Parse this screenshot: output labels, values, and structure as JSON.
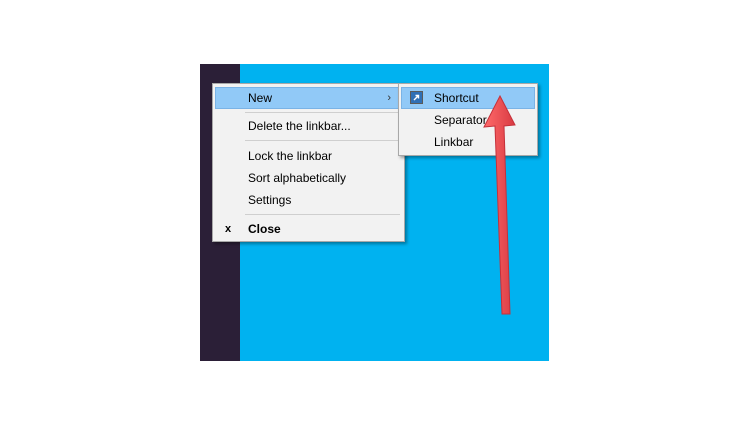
{
  "colors": {
    "desktop": "#00b2f0",
    "taskbar": "#2b1f37",
    "menu_bg": "#f2f2f2",
    "highlight": "#91c9f7",
    "arrow": "#e8474d"
  },
  "context_menu": {
    "new_label": "New",
    "new_chevron": "›",
    "delete_label": "Delete the linkbar...",
    "lock_label": "Lock the linkbar",
    "sort_label": "Sort alphabetically",
    "settings_label": "Settings",
    "close_glyph": "x",
    "close_label": "Close"
  },
  "submenu": {
    "shortcut_label": "Shortcut",
    "shortcut_icon": "shortcut-arrow-icon",
    "separator_label": "Separator",
    "linkbar_label": "Linkbar"
  },
  "annotation": {
    "icon": "red-arrow-icon"
  }
}
